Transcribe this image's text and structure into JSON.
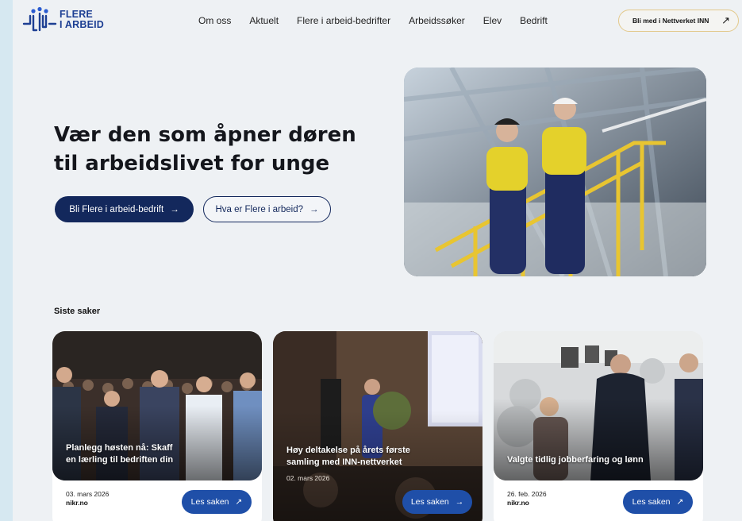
{
  "brand": {
    "line1": "FLERE",
    "line2": "I ARBEID",
    "color": "#1d3f93"
  },
  "nav": [
    "Om oss",
    "Aktuelt",
    "Flere i arbeid-bedrifter",
    "Arbeidssøker",
    "Elev",
    "Bedrift"
  ],
  "header_cta": {
    "label": "Bli med i Nettverket INN",
    "icon": "arrow-up-right-icon"
  },
  "hero": {
    "title_line1": "Vær den som åpner døren",
    "title_line2": "til arbeidslivet for unge",
    "primary_button": "Bli Flere i arbeid-bedrift",
    "secondary_button": "Hva er Flere i arbeid?",
    "arrow": "→"
  },
  "section": {
    "title": "Siste saker"
  },
  "cards": [
    {
      "title_line1": "Planlegg høsten nå: Skaff",
      "title_line2": "en lærling til bedriften din",
      "date": "03. mars 2026",
      "source": "nikr.no",
      "button": "Les saken",
      "button_icon": "↗"
    },
    {
      "title_line1": "Høy deltakelse på årets første",
      "title_line2": "samling med INN-nettverket",
      "date": "02. mars 2026",
      "source": "",
      "button": "Les saken",
      "button_icon": "→"
    },
    {
      "title_line1": "Valgte tidlig jobberfaring og lønn",
      "title_line2": "",
      "date": "26. feb. 2026",
      "source": "nikr.no",
      "button": "Les saken",
      "button_icon": "↗"
    }
  ],
  "colors": {
    "primary": "#13285c",
    "button_blue": "#1f4fa8",
    "page_bg": "#eef1f4",
    "cta_border": "#e3c98b"
  }
}
